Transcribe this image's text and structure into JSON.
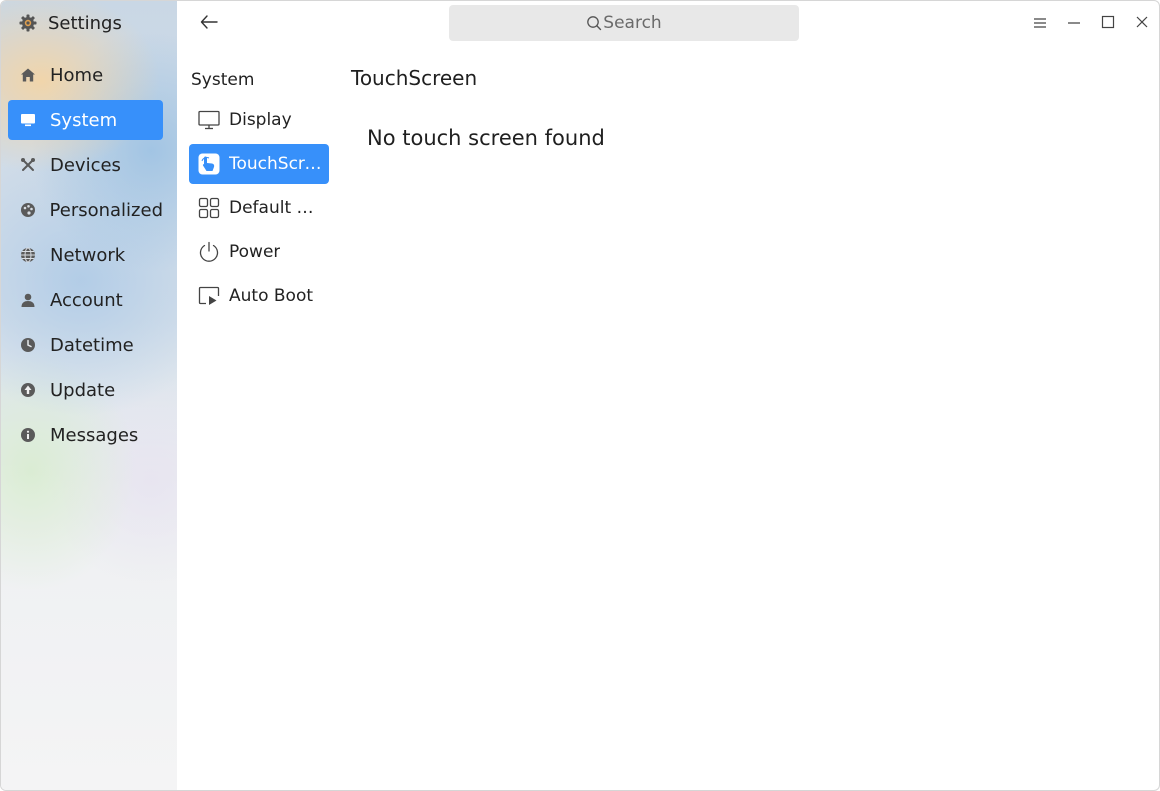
{
  "app": {
    "title": "Settings",
    "icon": "settings-gear-icon"
  },
  "nav": {
    "items": [
      {
        "label": "Home",
        "icon": "home-icon",
        "active": false
      },
      {
        "label": "System",
        "icon": "monitor-icon",
        "active": true
      },
      {
        "label": "Devices",
        "icon": "tools-icon",
        "active": false
      },
      {
        "label": "Personalized",
        "icon": "palette-icon",
        "active": false
      },
      {
        "label": "Network",
        "icon": "globe-icon",
        "active": false
      },
      {
        "label": "Account",
        "icon": "user-icon",
        "active": false
      },
      {
        "label": "Datetime",
        "icon": "clock-icon",
        "active": false
      },
      {
        "label": "Update",
        "icon": "update-icon",
        "active": false
      },
      {
        "label": "Messages",
        "icon": "info-icon",
        "active": false
      }
    ]
  },
  "titlebar": {
    "back_icon": "arrow-left-icon",
    "search_placeholder": "Search",
    "controls": [
      "menu-icon",
      "minimize-icon",
      "maximize-icon",
      "close-icon"
    ]
  },
  "system": {
    "title": "System",
    "items": [
      {
        "label": "Display",
        "icon": "display-icon",
        "active": false
      },
      {
        "label": "TouchScreen",
        "icon": "touchscreen-icon",
        "active": true
      },
      {
        "label": "Default App",
        "icon": "grid-icon",
        "active": false
      },
      {
        "label": "Power",
        "icon": "power-icon",
        "active": false
      },
      {
        "label": "Auto Boot",
        "icon": "autoboot-icon",
        "active": false
      }
    ]
  },
  "content": {
    "title": "TouchScreen",
    "message": "No touch screen found"
  },
  "colors": {
    "accent": "#3790fa",
    "search_bg": "#e8e8e8"
  }
}
